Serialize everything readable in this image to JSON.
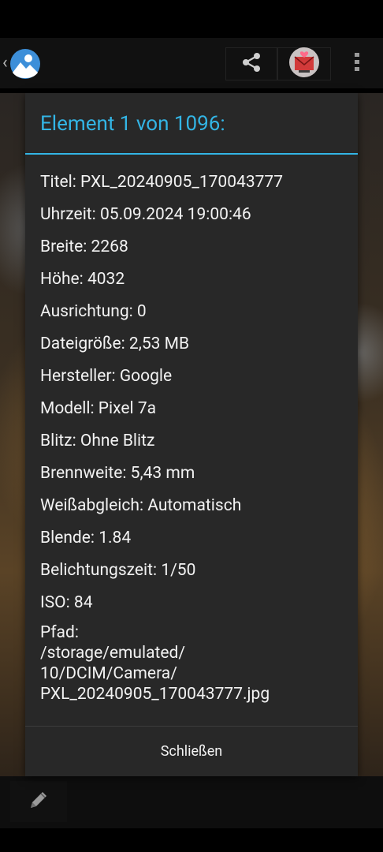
{
  "app": {
    "icon": "gallery-icon",
    "back_glyph": "‹"
  },
  "toolbar": {
    "share_icon": "share-icon",
    "mail_icon": "mail-heart-icon",
    "overflow_icon": "more-vert-icon"
  },
  "bottom_bar": {
    "edit_icon": "pencil-icon"
  },
  "colors": {
    "accent": "#33b5e5",
    "dialog_bg": "#282828",
    "text": "#f2f2f2"
  },
  "dialog": {
    "title": "Element 1 von 1096:",
    "rows": [
      "Titel: PXL_20240905_170043777",
      "Uhrzeit: 05.09.2024 19:00:46",
      "Breite: 2268",
      "Höhe: 4032",
      "Ausrichtung: 0",
      "Dateigröße: 2,53 MB",
      "Hersteller: Google",
      "Modell: Pixel 7a",
      "Blitz: Ohne Blitz",
      "Brennweite: 5,43 mm",
      "Weißabgleich: Automatisch",
      "Blende: 1.84",
      "Belichtungszeit: 1/50",
      "ISO: 84"
    ],
    "path_lines": [
      "Pfad:",
      "/storage/emulated/",
      "10/DCIM/Camera/",
      "PXL_20240905_170043777.jpg"
    ],
    "close_label": "Schließen"
  }
}
